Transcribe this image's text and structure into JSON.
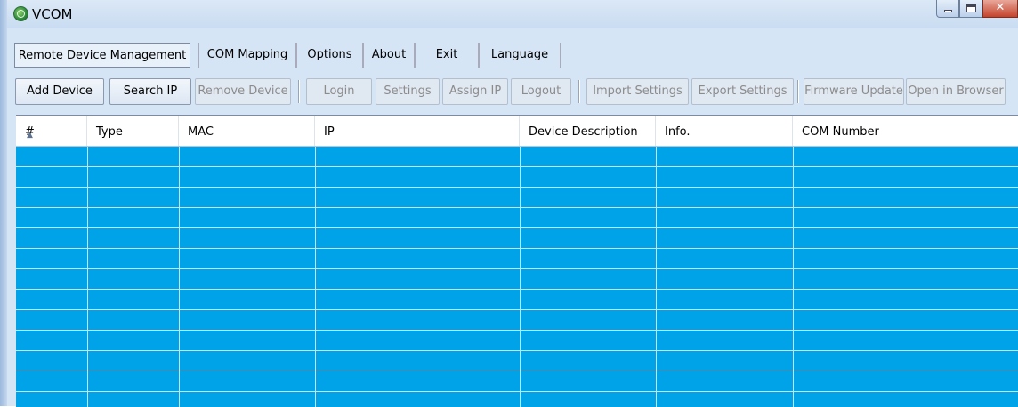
{
  "window": {
    "title": "VCOM",
    "icon": "globe-icon",
    "controls": [
      "minimize-icon",
      "maximize-icon",
      "close-icon"
    ]
  },
  "menu": {
    "items": [
      "Remote Device Management",
      "COM Mapping",
      "Options",
      "About",
      "Exit",
      "Language"
    ],
    "active": "Remote Device Management"
  },
  "toolbar": {
    "add_device": "Add Device",
    "search_ip": "Search IP",
    "remove_device": "Remove Device",
    "login": "Login",
    "settings": "Settings",
    "assign_ip": "Assign IP",
    "logout": "Logout",
    "import_settings": "Import Settings",
    "export_settings": "Export Settings",
    "firmware_update": "Firmware Update",
    "open_in_browser": "Open in Browser"
  },
  "table": {
    "columns": [
      "#",
      "Type",
      "MAC",
      "IP",
      "Device Description",
      "Info.",
      "COM Number"
    ],
    "sort_column": "#",
    "rows": []
  },
  "colors": {
    "row_highlight": "#00a2e8",
    "window_background": "#d6e5f5"
  }
}
